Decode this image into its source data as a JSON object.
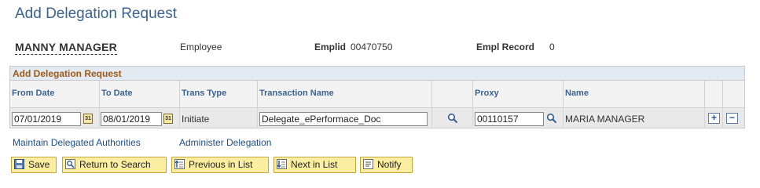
{
  "page": {
    "title": "Add Delegation Request"
  },
  "header": {
    "name": "MANNY MANAGER",
    "employee_label": "Employee",
    "emplid_label": "Emplid",
    "emplid_value": "00470750",
    "empl_record_label": "Empl Record",
    "empl_record_value": "0"
  },
  "grid": {
    "title": "Add Delegation Request",
    "columns": [
      "From Date",
      "To Date",
      "Trans Type",
      "Transaction Name",
      "Proxy",
      "Name"
    ],
    "row": {
      "from_date": "07/01/2019",
      "to_date": "08/01/2019",
      "trans_type": "Initiate",
      "transaction_name": "Delegate_ePerformace_Doc",
      "proxy": "00110157",
      "name": "MARIA MANAGER"
    },
    "add_row_label": "+",
    "delete_row_label": "−"
  },
  "links": {
    "maintain": "Maintain Delegated Authorities",
    "administer": "Administer Delegation"
  },
  "toolbar": {
    "save": "Save",
    "return": "Return to Search",
    "previous": "Previous in List",
    "next": "Next in List",
    "notify": "Notify"
  },
  "icons": {
    "calendar": "calendar-icon",
    "lookup": "magnifier-icon"
  },
  "colors": {
    "title": "#3c6390",
    "grid_title": "#9c5a16",
    "button_bg": "#fbeea0",
    "link": "#1d4e89"
  }
}
